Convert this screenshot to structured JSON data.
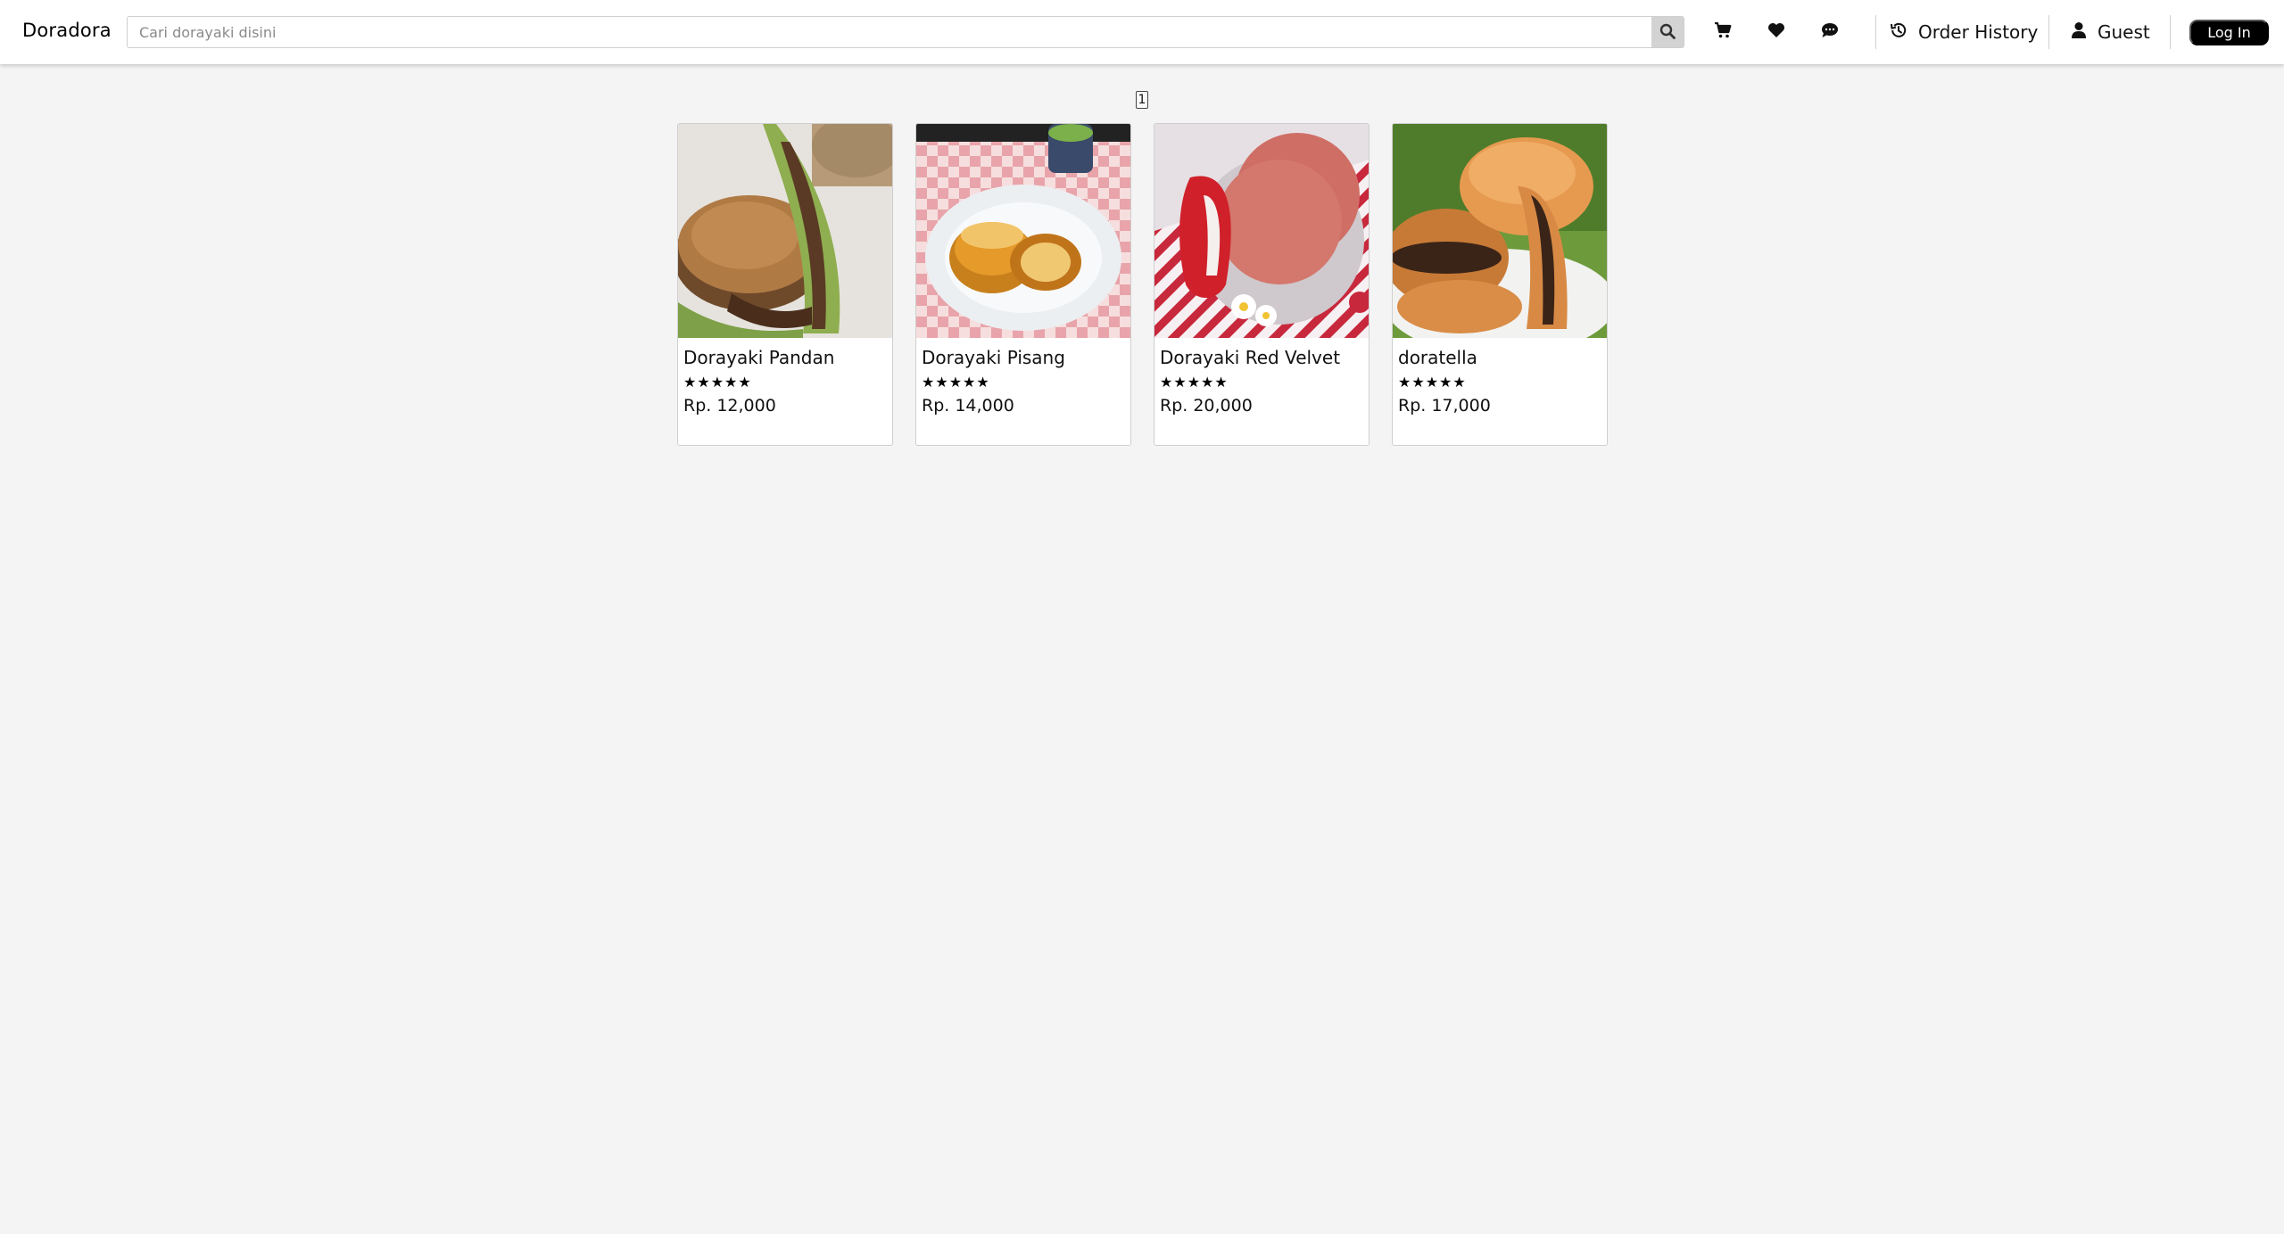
{
  "navbar": {
    "brand": "Doradora",
    "search": {
      "placeholder": "Cari dorayaki disini",
      "value": "",
      "button_icon": "search-icon"
    },
    "icons": [
      "cart-icon",
      "heart-icon",
      "chat-icon"
    ],
    "order_history_label": "Order History",
    "order_history_icon": "history-icon",
    "user_label": "Guest",
    "user_icon": "user-icon",
    "login_label": "Log In"
  },
  "pagination": {
    "current_page": "1"
  },
  "products": [
    {
      "name": "Dorayaki Pandan",
      "stars": "★★★★★",
      "rating": 5,
      "price": "Rp. 12,000"
    },
    {
      "name": "Dorayaki Pisang",
      "stars": "★★★★★",
      "rating": 5,
      "price": "Rp. 14,000"
    },
    {
      "name": "Dorayaki Red Velvet",
      "stars": "★★★★★",
      "rating": 5,
      "price": "Rp. 20,000"
    },
    {
      "name": "doratella",
      "stars": "★★★★★",
      "rating": 5,
      "price": "Rp. 17,000"
    }
  ],
  "colors": {
    "page_background": "#f4f4f4",
    "navbar_background": "#ffffff",
    "login_button": "#000000",
    "search_button": "#d3d3d3"
  }
}
